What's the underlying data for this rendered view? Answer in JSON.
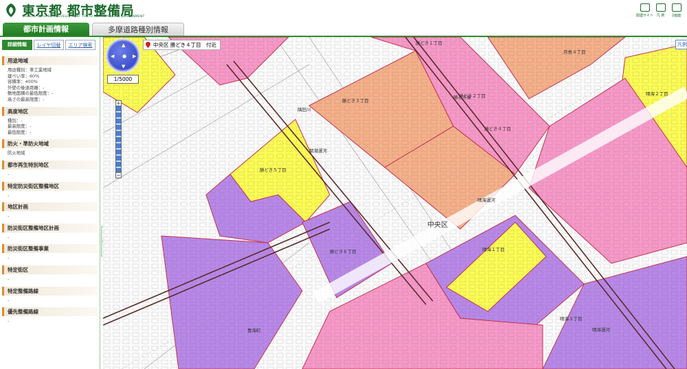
{
  "header": {
    "logo_title": "東京都 都市整備局",
    "logo_subtitle": "BUREAU OF URBAN DEVELOPMENT TOKYO METROPOLITAN GOVERNMENT",
    "tools": [
      {
        "icon": "sitemap-icon",
        "label": "関連サイト"
      },
      {
        "icon": "legend-icon",
        "label": "凡 例"
      },
      {
        "icon": "dual-screen-icon",
        "label": "2画面"
      }
    ]
  },
  "tabs": [
    {
      "label": "都市計画情報",
      "active": true
    },
    {
      "label": "多摩道路種別情報",
      "active": false
    }
  ],
  "sidebar": {
    "subtabs": [
      "詳細情報",
      "レイヤ切替",
      "エリア検索"
    ],
    "sections": [
      {
        "title": "用途地域",
        "lines": [
          "用途種別：準工業地域",
          "建ぺい率：60%",
          "容積率：400%",
          "外壁の後退距離：-",
          "敷地面積の最低限度：-",
          "高さの最高限度：-"
        ]
      },
      {
        "title": "高度地区",
        "lines": [
          "種別：-",
          "最高限度：-",
          "最低限度：-"
        ]
      },
      {
        "title": "防火・準防火地域",
        "lines": [
          "防火地域"
        ]
      },
      {
        "title": "都市再生特別地区",
        "lines": [
          "-"
        ]
      },
      {
        "title": "特定防災街区整備地区",
        "lines": [
          "-"
        ]
      },
      {
        "title": "地区計画",
        "lines": [
          "-"
        ]
      },
      {
        "title": "防災街区整備地区計画",
        "lines": [
          "-"
        ]
      },
      {
        "title": "防災街区整備事業",
        "lines": [
          "-"
        ]
      },
      {
        "title": "特定街区",
        "lines": [
          "-"
        ]
      },
      {
        "title": "特定整備路線",
        "lines": [
          "-"
        ]
      },
      {
        "title": "優先整備路線",
        "lines": [
          "-"
        ]
      }
    ],
    "collapse_label": "«"
  },
  "map": {
    "scale": "1/5000",
    "location": "中央区 勝どき４丁目　付近",
    "legend_button": "凡例",
    "place_label": "中央区",
    "block_labels": [
      {
        "text": "勝どき１丁目"
      },
      {
        "text": "勝どき３丁目"
      },
      {
        "text": "勝どき２丁目"
      },
      {
        "text": "勝どき４丁目"
      },
      {
        "text": "勝どき５丁目"
      },
      {
        "text": "勝どき６丁目"
      },
      {
        "text": "勝どき東"
      },
      {
        "text": "月島４丁目"
      },
      {
        "text": "晴海２丁目"
      },
      {
        "text": "晴海１丁目"
      },
      {
        "text": "晴海３丁目"
      },
      {
        "text": "隅田川"
      },
      {
        "text": "朝潮運河"
      },
      {
        "text": "晴海運河"
      },
      {
        "text": "豊海町"
      },
      {
        "text": "晴海運河"
      }
    ],
    "zone_colors": {
      "commercial": "#f799c8",
      "neighborhood_commercial": "#f5b08a",
      "quasi_industrial": "#b888e8",
      "residential": "#fcfc55",
      "boundary": "#c83050",
      "rail": "#5a2a2a"
    }
  }
}
